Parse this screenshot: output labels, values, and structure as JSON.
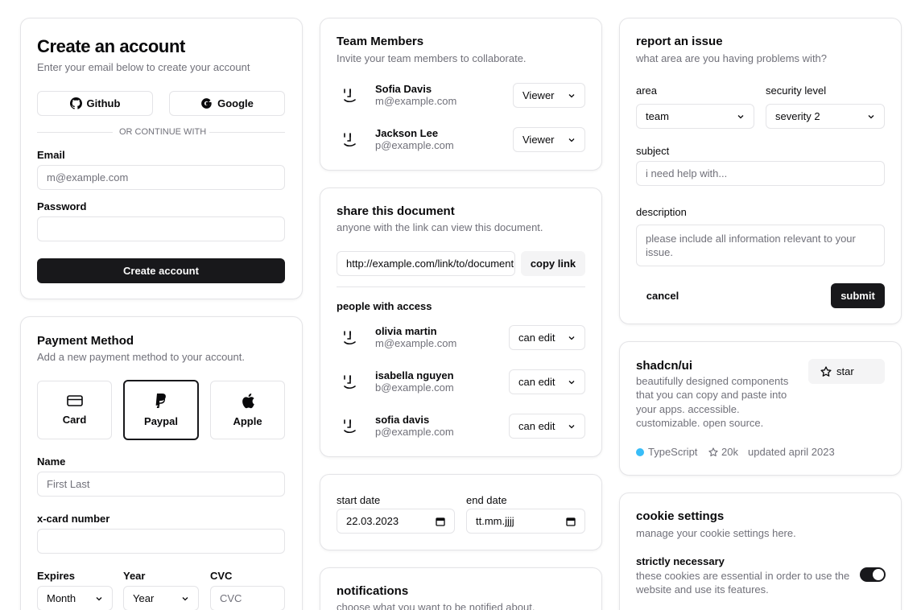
{
  "create_account": {
    "title": "Create an account",
    "subtitle": "Enter your email below to create your account",
    "github_label": "Github",
    "google_label": "Google",
    "divider_text": "OR CONTINUE WITH",
    "email_label": "Email",
    "email_placeholder": "m@example.com",
    "password_label": "Password",
    "submit_label": "Create account"
  },
  "payment": {
    "title": "Payment Method",
    "subtitle": "Add a new payment method to your account.",
    "options": [
      "Card",
      "Paypal",
      "Apple"
    ],
    "selected": "Paypal",
    "name_label": "Name",
    "name_placeholder": "First Last",
    "card_label": "x-card number",
    "expires_label": "Expires",
    "month_value": "Month",
    "year_label": "Year",
    "year_value": "Year",
    "cvc_label": "CVC",
    "cvc_placeholder": "CVC"
  },
  "team": {
    "title": "Team Members",
    "subtitle": "Invite your team members to collaborate.",
    "members": [
      {
        "name": "Sofia Davis",
        "email": "m@example.com",
        "role": "Viewer"
      },
      {
        "name": "Jackson Lee",
        "email": "p@example.com",
        "role": "Viewer"
      }
    ]
  },
  "share": {
    "title": "share this document",
    "subtitle": "anyone with the link can view this document.",
    "link_value": "http://example.com/link/to/document",
    "copy_label": "copy link",
    "access_title": "people with access",
    "people": [
      {
        "name": "olivia martin",
        "email": "m@example.com",
        "role": "can edit"
      },
      {
        "name": "isabella nguyen",
        "email": "b@example.com",
        "role": "can edit"
      },
      {
        "name": "sofia davis",
        "email": "p@example.com",
        "role": "can edit"
      }
    ]
  },
  "dates": {
    "start_label": "start date",
    "start_value": "22.03.2023",
    "end_label": "end date",
    "end_value": "tt.mm.jjjj"
  },
  "notifications": {
    "title": "notifications",
    "subtitle": "choose what you want to be notified about."
  },
  "issue": {
    "title": "report an issue",
    "subtitle": "what area are you having problems with?",
    "area_label": "area",
    "area_value": "team",
    "security_label": "security level",
    "security_value": "severity 2",
    "subject_label": "subject",
    "subject_placeholder": "i need help with...",
    "description_label": "description",
    "description_placeholder": "please include all information relevant to your issue.",
    "cancel_label": "cancel",
    "submit_label": "submit"
  },
  "repo": {
    "title": "shadcn/ui",
    "description": "beautifully designed components that you can copy and paste into your apps. accessible. customizable. open source.",
    "star_label": "star",
    "language": "TypeScript",
    "language_color": "#38bdf8",
    "stars": "20k",
    "updated": "updated april 2023"
  },
  "cookies": {
    "title": "cookie settings",
    "subtitle": "manage your cookie settings here.",
    "strict_label": "strictly necessary",
    "strict_description": "these cookies are essential in order to use the website and use its features.",
    "strict_enabled": true
  }
}
